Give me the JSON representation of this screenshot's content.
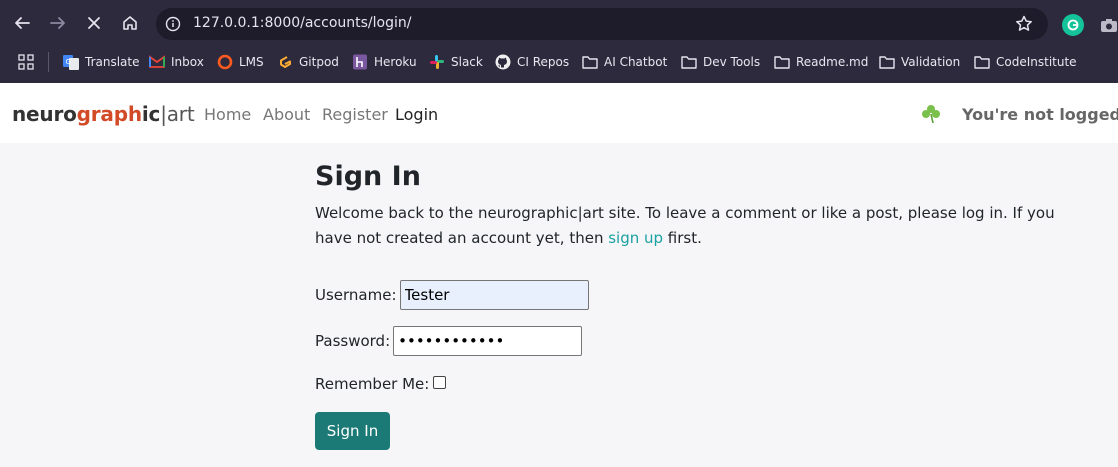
{
  "browser": {
    "url": "127.0.0.1:8000/accounts/login/",
    "bookmarks": [
      "Translate",
      "Inbox",
      "LMS",
      "Gitpod",
      "Heroku",
      "Slack",
      "CI Repos",
      "AI Chatbot",
      "Dev Tools",
      "Readme.md",
      "Validation",
      "CodeInstitute"
    ],
    "icons": [
      "back-icon",
      "forward-icon",
      "stop-loading-icon",
      "home-icon",
      "site-info-icon",
      "bookmark-star-icon",
      "grammarly-icon",
      "camera-icon",
      "apps-grid-icon"
    ]
  },
  "navbar": {
    "brand": {
      "part1": "neuro",
      "part2": "graph",
      "part3": "ic",
      "part4": "|art"
    },
    "links": [
      "Home",
      "About",
      "Register",
      "Login"
    ],
    "active": "Login",
    "status": "You're not logged in"
  },
  "page": {
    "title": "Sign In",
    "intro_before": "Welcome back to the neurographic|art site. To leave a comment or like a post, please log in. If you have not created an account yet, then ",
    "intro_link": "sign up",
    "intro_after": " first.",
    "username_label": "Username:",
    "username_value": "Tester",
    "password_label": "Password:",
    "password_value": "••••••••••••",
    "remember_label": "Remember Me:",
    "submit_label": "Sign In"
  },
  "colors": {
    "chrome": "#2e2a3d",
    "brand_accent": "#d24a26",
    "link": "#1aa1a1",
    "button": "#1b7a75"
  }
}
